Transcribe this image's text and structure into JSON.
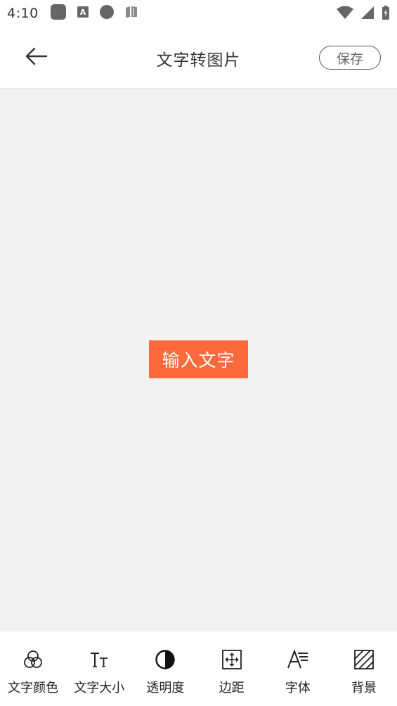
{
  "status_bar": {
    "time": "4:10",
    "left_icons": [
      "app-square-icon",
      "a-notification-icon",
      "circle-dot-icon",
      "book-icon"
    ],
    "right_icons": [
      "wifi-icon",
      "signal-icon",
      "battery-charging-icon"
    ]
  },
  "app_bar": {
    "back_icon": "arrow-left-icon",
    "title": "文字转图片",
    "save_label": "保存"
  },
  "canvas": {
    "text_block_label": "输入文字",
    "text_block_color": "#ff6a3d",
    "background_color": "#f2f2f2"
  },
  "toolbar": {
    "items": [
      {
        "label": "文字颜色",
        "icon": "color-circles-icon"
      },
      {
        "label": "文字大小",
        "icon": "text-size-icon"
      },
      {
        "label": "透明度",
        "icon": "opacity-icon"
      },
      {
        "label": "边距",
        "icon": "padding-icon"
      },
      {
        "label": "字体",
        "icon": "font-icon"
      },
      {
        "label": "背景",
        "icon": "background-icon"
      }
    ]
  }
}
